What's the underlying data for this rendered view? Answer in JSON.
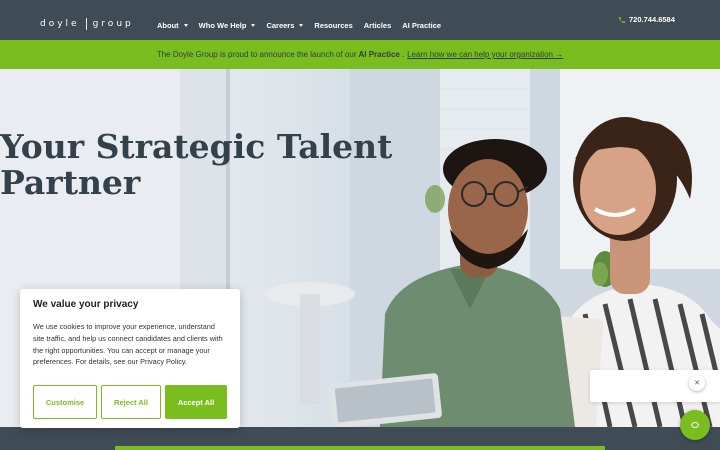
{
  "header": {
    "logo_left": "doyle",
    "logo_right": "group",
    "nav": [
      {
        "label": "About",
        "dropdown": true
      },
      {
        "label": "Who We Help",
        "dropdown": true
      },
      {
        "label": "Careers",
        "dropdown": true
      },
      {
        "label": "Resources",
        "dropdown": false
      },
      {
        "label": "Articles",
        "dropdown": false
      },
      {
        "label": "AI Practice",
        "dropdown": false
      }
    ],
    "phone": "720.744.6584"
  },
  "announcement": {
    "prefix": "The Doyle Group is proud to announce the launch of our",
    "highlight": "AI Practice",
    "suffix": ".",
    "link": "Learn how we can help your organization →"
  },
  "hero": {
    "title_line1": "Your Strategic Talent",
    "title_line2": "Partner"
  },
  "cookie": {
    "title": "We value your privacy",
    "body": "We use cookies to improve your experience, understand site traffic, and help us connect candidates and clients with the right opportunities. You can accept or manage your preferences. For details, see our Privacy Policy.",
    "customise": "Customise",
    "reject": "Reject All",
    "accept": "Accept All"
  },
  "chat": {
    "close_icon": "close-icon",
    "launcher_icon": "chat-icon"
  },
  "colors": {
    "header_bg": "#3f4c55",
    "accent_green": "#79bd1f",
    "title_text": "#32414a"
  }
}
